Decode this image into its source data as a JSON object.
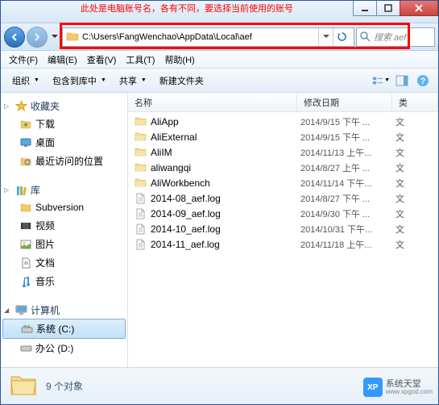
{
  "annotation": "此处是电脑账号名，各有不同，要选择当前使用的账号",
  "address": {
    "path": "C:\\Users\\FangWenchao\\AppData\\Local\\aef"
  },
  "search": {
    "placeholder": "搜索 aef"
  },
  "menubar": {
    "file": "文件(F)",
    "edit": "编辑(E)",
    "view": "查看(V)",
    "tools": "工具(T)",
    "help": "帮助(H)"
  },
  "toolbar": {
    "organize": "组织",
    "include": "包含到库中",
    "share": "共享",
    "newfolder": "新建文件夹"
  },
  "columns": {
    "name": "名称",
    "date": "修改日期",
    "type": "类"
  },
  "sidebar": {
    "favorites": {
      "label": "收藏夹"
    },
    "downloads": {
      "label": "下载"
    },
    "desktop": {
      "label": "桌面"
    },
    "recent": {
      "label": "最近访问的位置"
    },
    "libraries": {
      "label": "库"
    },
    "subversion": {
      "label": "Subversion"
    },
    "videos": {
      "label": "视频"
    },
    "pictures": {
      "label": "图片"
    },
    "documents": {
      "label": "文档"
    },
    "music": {
      "label": "音乐"
    },
    "computer": {
      "label": "计算机"
    },
    "drive_c": {
      "label": "系统 (C:)"
    },
    "drive_d": {
      "label": "办公 (D:)"
    }
  },
  "files": [
    {
      "name": "AliApp",
      "date": "2014/9/15 下午 ...",
      "type": "文",
      "kind": "folder"
    },
    {
      "name": "AliExternal",
      "date": "2014/9/15 下午 ...",
      "type": "文",
      "kind": "folder"
    },
    {
      "name": "AliIM",
      "date": "2014/11/13 上午...",
      "type": "文",
      "kind": "folder"
    },
    {
      "name": "aliwangqi",
      "date": "2014/8/27 上午 ...",
      "type": "文",
      "kind": "folder"
    },
    {
      "name": "AliWorkbench",
      "date": "2014/11/14 下午...",
      "type": "文",
      "kind": "folder"
    },
    {
      "name": "2014-08_aef.log",
      "date": "2014/8/27 下午 ...",
      "type": "文",
      "kind": "file"
    },
    {
      "name": "2014-09_aef.log",
      "date": "2014/9/30 下午 ...",
      "type": "文",
      "kind": "file"
    },
    {
      "name": "2014-10_aef.log",
      "date": "2014/10/31 下午...",
      "type": "文",
      "kind": "file"
    },
    {
      "name": "2014-11_aef.log",
      "date": "2014/11/18 上午...",
      "type": "文",
      "kind": "file"
    }
  ],
  "status": {
    "count": "9 个对象"
  },
  "watermark": {
    "brand": "系统天堂",
    "url": "www.xpgod.com"
  }
}
